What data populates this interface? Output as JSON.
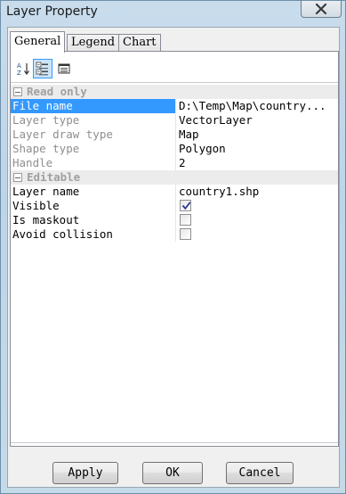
{
  "window": {
    "title": "Layer Property"
  },
  "tabs": [
    {
      "label": "General",
      "active": true
    },
    {
      "label": "Legend",
      "active": false
    },
    {
      "label": "Chart",
      "active": false
    }
  ],
  "toolbar": {
    "icons": [
      "sort-alphabetical-icon",
      "categorized-icon",
      "property-pages-icon"
    ]
  },
  "grid": {
    "categories": {
      "read_only": "Read only",
      "editable": "Editable"
    },
    "read_only_rows": [
      {
        "name": "File name",
        "value": "D:\\Temp\\Map\\country..."
      },
      {
        "name": "Layer type",
        "value": "VectorLayer"
      },
      {
        "name": "Layer draw type",
        "value": "Map"
      },
      {
        "name": "Shape type",
        "value": "Polygon"
      },
      {
        "name": "Handle",
        "value": "2"
      }
    ],
    "editable_rows": [
      {
        "name": "Layer name",
        "value": "country1.shp"
      },
      {
        "name": "Visible",
        "checked": true
      },
      {
        "name": "Is maskout",
        "checked": false
      },
      {
        "name": "Avoid collision",
        "checked": false
      }
    ]
  },
  "buttons": {
    "apply": "Apply",
    "ok": "OK",
    "cancel": "Cancel"
  },
  "colors": {
    "selection": "#3399ff",
    "category_bg": "#ececec",
    "readonly_text": "#8e8e8e"
  }
}
